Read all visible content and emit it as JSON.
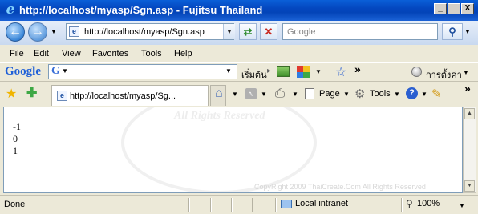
{
  "window": {
    "title": "http://localhost/myasp/Sgn.asp - Fujitsu Thailand",
    "minimize": "_",
    "maximize": "□",
    "close": "X"
  },
  "address_bar": {
    "url": "http://localhost/myasp/Sgn.asp"
  },
  "search_box": {
    "placeholder": "Google"
  },
  "menu": {
    "items": [
      "File",
      "Edit",
      "View",
      "Favorites",
      "Tools",
      "Help"
    ]
  },
  "google_toolbar": {
    "logo": "Google",
    "start_label": "เริ่มต้น",
    "chevron": "»",
    "settings_label": "การตั้งค่า"
  },
  "tabs": [
    {
      "label": "http://localhost/myasp/Sg..."
    }
  ],
  "command_bar": {
    "page_label": "Page",
    "tools_label": "Tools",
    "chevron": "»"
  },
  "content": {
    "lines": [
      "-1",
      "0",
      "1"
    ],
    "watermark": "CopyRight 2009 ThaiCreate.Com All Rights Reserved",
    "seal_text": "All Rights Reserved"
  },
  "status_bar": {
    "status": "Done",
    "zone": "Local intranet",
    "zoom": "100%"
  }
}
